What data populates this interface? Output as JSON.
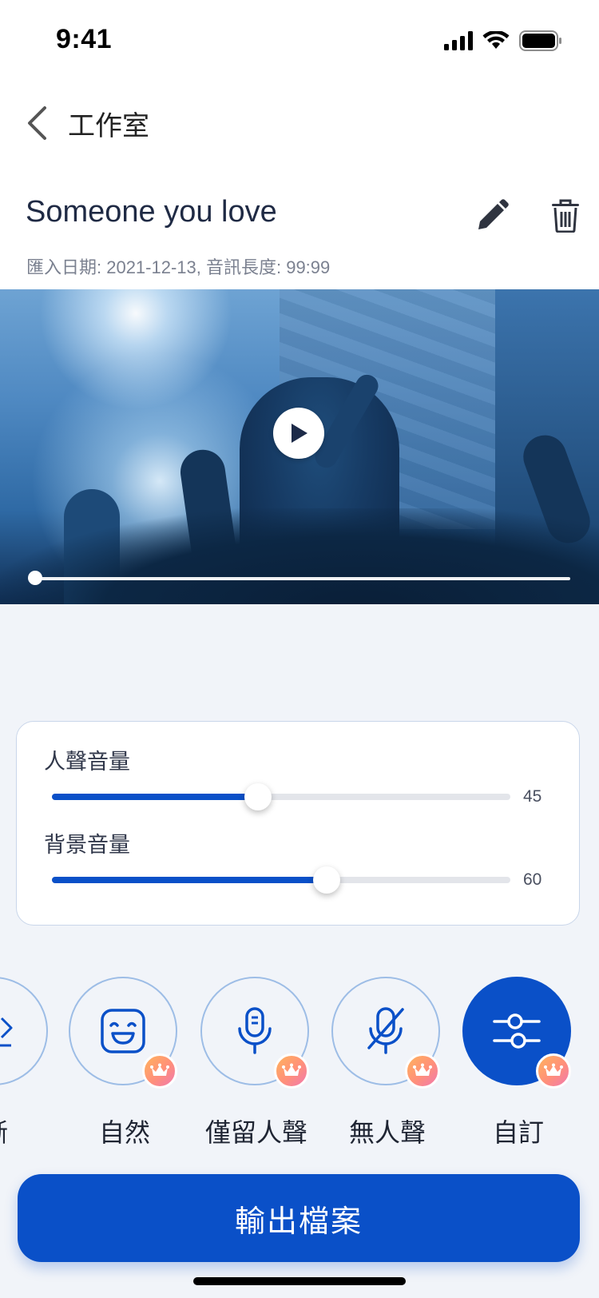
{
  "status_bar": {
    "time": "9:41"
  },
  "nav": {
    "title": "工作室",
    "back_icon": "chevron-left-icon"
  },
  "song": {
    "title": "Someone you love",
    "meta": "匯入日期: 2021-12-13, 音訊長度: 99:99",
    "edit_icon": "pencil-icon",
    "delete_icon": "trash-icon"
  },
  "player": {
    "play_icon": "play-icon",
    "progress": 0.0
  },
  "volumes": [
    {
      "label": "人聲音量",
      "value": "45",
      "level": 45
    },
    {
      "label": "背景音量",
      "value": "60",
      "level": 60
    }
  ],
  "modes": [
    {
      "label": "晰",
      "icon": "clarity-icon",
      "premium": false,
      "active": false
    },
    {
      "label": "自然",
      "icon": "smile-face-icon",
      "premium": true,
      "active": false
    },
    {
      "label": "僅留人聲",
      "icon": "microphone-icon",
      "premium": true,
      "active": false
    },
    {
      "label": "無人聲",
      "icon": "microphone-off-icon",
      "premium": true,
      "active": false
    },
    {
      "label": "自訂",
      "icon": "sliders-icon",
      "premium": true,
      "active": true
    }
  ],
  "export": {
    "label": "輸出檔案"
  },
  "colors": {
    "primary": "#0a50c8",
    "mode_border": "#9dbde6",
    "panel_bg": "#f1f4f9"
  }
}
